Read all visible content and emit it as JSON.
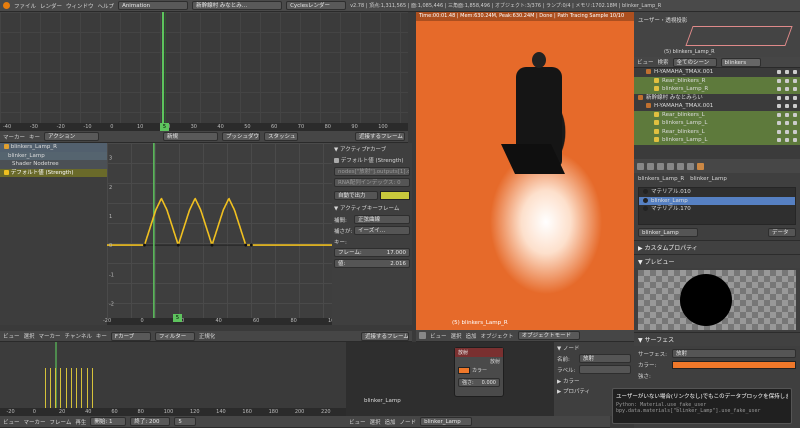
{
  "topbar": {
    "menus": [
      "ファイル",
      "レンダー",
      "ウィンドウ",
      "ヘルプ"
    ],
    "layout": "Animation",
    "scene": "新幹線村 みなとみ…",
    "engine": "Cyclesレンダー",
    "stats": "v2.78 | 頂点:1,311,565 | 面:1,085,446 | 三角面:1,858,496 | オブジェクト:3/376 | ランプ:0/4 | メモリ:1702.18M | blinker_Lamp_R"
  },
  "timeline_top": {
    "ticks": [
      "-40",
      "-30",
      "-20",
      "-10",
      "0",
      "10",
      "20",
      "30",
      "40",
      "50",
      "60",
      "70",
      "80",
      "90",
      "100"
    ],
    "frame_badge": "5",
    "header": {
      "menu1": "マーカー",
      "menu2": "キー",
      "mode": "アクション",
      "new": "新規",
      "push": "プッシュダウン",
      "stash": "スタッシュ",
      "nearest": "近接するフレーム"
    }
  },
  "fcurve": {
    "channels": [
      {
        "label": "blinkers_Lamp_R",
        "sel": false
      },
      {
        "label": "blinker_Lamp",
        "sel": false
      },
      {
        "label": "Shader Nodetree",
        "sel": false
      },
      {
        "label": "デフォルト値 (Strength)",
        "sel": true
      }
    ],
    "y_ticks": [
      "3",
      "2",
      "1",
      "0",
      "-1",
      "-2"
    ],
    "x_ticks": [
      "-20",
      "0",
      "20",
      "40",
      "60",
      "80",
      "100"
    ],
    "frame_badge": "5",
    "header": {
      "view": "ビュー",
      "select": "選択",
      "marker": "マーカー",
      "channel": "チャンネル",
      "key": "キー",
      "mode": "Fカーブ",
      "filter": "フィルター",
      "normalize": "正規化",
      "nearest": "近接するフレーム"
    }
  },
  "chart_data": {
    "type": "line",
    "x": [
      0,
      3,
      6,
      9,
      12,
      15,
      18,
      21,
      24,
      27,
      30,
      33,
      36,
      39,
      42,
      45,
      48,
      51,
      54,
      57
    ],
    "values": [
      0,
      0.6,
      1.2,
      1.6,
      1.2,
      0.6,
      0,
      0.6,
      1.2,
      1.6,
      1.2,
      0.6,
      0,
      0.6,
      1.2,
      1.6,
      1.2,
      0.6,
      0,
      0
    ],
    "xlim": [
      -20,
      100
    ],
    "ylim": [
      -2.5,
      3.5
    ]
  },
  "fcurve_props": {
    "active_curve": "アクティブFカーブ",
    "default_value": "デフォルト値 (Strength)",
    "path": "nodes[\"放射\"].outputs[1].default_value",
    "rna_index": "RNA配列インデックス: 0",
    "color_mode": "自動で出力",
    "color_swatch": "#c8c83c",
    "active_key": "アクティブキーフレーム",
    "interp_label": "補間:",
    "interp": "正弦曲線",
    "easing_label": "補さが:",
    "easing": "イーズイ…",
    "key_label": "キー:",
    "frame_label": "フレーム:",
    "frame": "17.000",
    "value_label": "値:",
    "value": "2.016"
  },
  "render": {
    "info": "Time:00:01.48 | Mem:630.24M, Peak:630.24M | Done | Path Tracing Sample 10/10",
    "object_label": "(5) blinkers_Lamp_R",
    "header": {
      "view": "ビュー",
      "select": "選択",
      "add": "追加",
      "object": "オブジェクト",
      "mode": "オブジェクトモード"
    }
  },
  "viewport_small": {
    "title": "ユーザー・透視投影",
    "label": "(5) blinkers_Lamp_R"
  },
  "outliner": {
    "header": {
      "view": "ビュー",
      "search": "検索",
      "scope": "全てのシーン",
      "filter": "blinkers"
    },
    "rows": [
      {
        "label": "H-YAMAHA_TMAX.001",
        "indent": 1,
        "sel": false
      },
      {
        "label": "Rear_blinkers_R",
        "indent": 2,
        "sel": true
      },
      {
        "label": "blinkers_Lamp_R",
        "indent": 2,
        "sel": true
      },
      {
        "label": "新幹線村 みなとみらい",
        "indent": 0,
        "sel": false
      },
      {
        "label": "H-YAMAHA_TMAX.001",
        "indent": 1,
        "sel": false
      },
      {
        "label": "Rear_blinkers_L",
        "indent": 2,
        "sel": true
      },
      {
        "label": "blinkers_Lamp_L",
        "indent": 2,
        "sel": true
      },
      {
        "label": "Rear_blinkers_L",
        "indent": 2,
        "sel": true
      },
      {
        "label": "blinkers_Lamp_L",
        "indent": 2,
        "sel": true
      }
    ]
  },
  "properties": {
    "object": "blinkers_Lamp_R",
    "material_tab": "blinker_Lamp",
    "materials": [
      {
        "label": "マテリアル.010",
        "sel": false
      },
      {
        "label": "blinker_Lamp",
        "sel": true
      },
      {
        "label": "マテリアル.170",
        "sel": false
      }
    ],
    "mat_name": "blinker_Lamp",
    "data_btn": "データ",
    "custom_props": "カスタムプロパティ",
    "preview": "プレビュー",
    "surface": "サーフェス",
    "surface_label": "サーフェス:",
    "surface_value": "放射",
    "color_label": "カラー:",
    "color_value": "#f0782a",
    "strength_label": "強さ:"
  },
  "dopesheet": {
    "x_ticks": [
      "-20",
      "0",
      "20",
      "40",
      "60",
      "80",
      "100",
      "120",
      "140",
      "160",
      "180",
      "200",
      "220"
    ],
    "key_frames": [
      6,
      10,
      14,
      18,
      22,
      26,
      30,
      34,
      38,
      42
    ],
    "header": {
      "view": "ビュー",
      "marker": "マーカー",
      "frame": "フレーム",
      "play": "再生",
      "start_label": "開始:",
      "start": "1",
      "end_label": "終了:",
      "end": "200",
      "current": "5"
    }
  },
  "node_editor": {
    "node_title": "放射",
    "out_label": "放射",
    "color_label": "カラー",
    "strength_label": "強さ:",
    "strength_value": "0.000",
    "material": "blinker_Lamp",
    "header": {
      "view": "ビュー",
      "select": "選択",
      "add": "追加",
      "node": "ノード",
      "material": "blinker_Lamp"
    }
  },
  "node_props": {
    "node_section": "ノード",
    "name_label": "名前:",
    "name_value": "放射",
    "label_label": "ラベル:",
    "color_section": "カラー",
    "props_section": "プロパティ"
  },
  "tooltip": {
    "title": "ユーザーがいない場合(リンクなし)でもこのデータブロックを保持します",
    "line1": "Python: Material.use_fake_user",
    "line2": "bpy.data.materials[\"blinker_Lamp\"].use_fake_user"
  }
}
